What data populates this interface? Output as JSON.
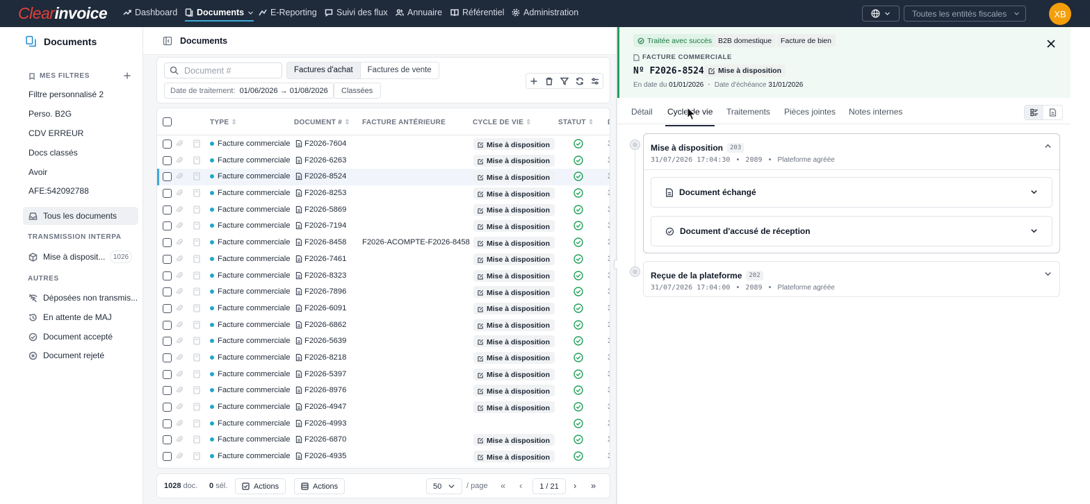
{
  "nav": {
    "logo_a": "Clear",
    "logo_b": "invoice",
    "items": [
      {
        "label": "Dashboard",
        "icon": "trend-icon"
      },
      {
        "label": "Documents",
        "icon": "documents-icon"
      },
      {
        "label": "E-Reporting",
        "icon": "ereporting-icon"
      },
      {
        "label": "Suivi des flux",
        "icon": "chat-icon"
      },
      {
        "label": "Annuaire",
        "icon": "users-icon"
      },
      {
        "label": "Référentiel",
        "icon": "book-icon"
      },
      {
        "label": "Administration",
        "icon": "gear-icon"
      }
    ],
    "entity_placeholder": "Toutes les entités fiscales",
    "avatar": "XB"
  },
  "sidebar": {
    "title": "Documents",
    "filters_header": "MES FILTRES",
    "filters": [
      "Filtre personnalisé 2",
      "Perso. B2G",
      "CDV ERREUR",
      "Docs classés",
      "Avoir",
      "AFE:542092788"
    ],
    "all_docs": "Tous les documents",
    "interpa_header": "TRANSMISSION INTERPA",
    "interpa_item": "Mise à disposit...",
    "interpa_count": "1026",
    "autres_header": "AUTRES",
    "autres": [
      "Déposées non transmis...",
      "En attente de MAJ",
      "Document accepté",
      "Document rejeté"
    ]
  },
  "main": {
    "title": "Documents",
    "search_placeholder": "Document #",
    "seg_purchase": "Factures d'achat",
    "seg_sales": "Factures de vente",
    "date_label": "Date de traitement:",
    "date_value": "01/06/2026 → 01/08/2026",
    "classees": "Classées"
  },
  "table": {
    "headers": {
      "type": "TYPE",
      "doc": "DOCUMENT #",
      "prev": "FACTURE ANTÉRIEURE",
      "cycle": "CYCLE DE VIE",
      "status": "STATUT",
      "trail": "D"
    },
    "rows": [
      {
        "type": "Facture commerciale",
        "doc": "F2026-7604",
        "prev": "",
        "cycle": "Mise à disposition"
      },
      {
        "type": "Facture commerciale",
        "doc": "F2026-6263",
        "prev": "",
        "cycle": "Mise à disposition"
      },
      {
        "type": "Facture commerciale",
        "doc": "F2026-8524",
        "prev": "",
        "cycle": "Mise à disposition",
        "selected": true
      },
      {
        "type": "Facture commerciale",
        "doc": "F2026-8253",
        "prev": "",
        "cycle": "Mise à disposition"
      },
      {
        "type": "Facture commerciale",
        "doc": "F2026-5869",
        "prev": "",
        "cycle": "Mise à disposition"
      },
      {
        "type": "Facture commerciale",
        "doc": "F2026-7194",
        "prev": "",
        "cycle": "Mise à disposition"
      },
      {
        "type": "Facture commerciale",
        "doc": "F2026-8458",
        "prev": "F2026-ACOMPTE-F2026-8458",
        "cycle": "Mise à disposition"
      },
      {
        "type": "Facture commerciale",
        "doc": "F2026-7461",
        "prev": "",
        "cycle": "Mise à disposition"
      },
      {
        "type": "Facture commerciale",
        "doc": "F2026-8323",
        "prev": "",
        "cycle": "Mise à disposition"
      },
      {
        "type": "Facture commerciale",
        "doc": "F2026-7896",
        "prev": "",
        "cycle": "Mise à disposition"
      },
      {
        "type": "Facture commerciale",
        "doc": "F2026-6091",
        "prev": "",
        "cycle": "Mise à disposition"
      },
      {
        "type": "Facture commerciale",
        "doc": "F2026-6862",
        "prev": "",
        "cycle": "Mise à disposition"
      },
      {
        "type": "Facture commerciale",
        "doc": "F2026-5639",
        "prev": "",
        "cycle": "Mise à disposition"
      },
      {
        "type": "Facture commerciale",
        "doc": "F2026-8218",
        "prev": "",
        "cycle": "Mise à disposition"
      },
      {
        "type": "Facture commerciale",
        "doc": "F2026-5397",
        "prev": "",
        "cycle": "Mise à disposition"
      },
      {
        "type": "Facture commerciale",
        "doc": "F2026-8976",
        "prev": "",
        "cycle": "Mise à disposition"
      },
      {
        "type": "Facture commerciale",
        "doc": "F2026-4947",
        "prev": "",
        "cycle": "Mise à disposition"
      },
      {
        "type": "Facture commerciale",
        "doc": "F2026-4993",
        "prev": "",
        "cycle": ""
      },
      {
        "type": "Facture commerciale",
        "doc": "F2026-6870",
        "prev": "",
        "cycle": "Mise à disposition"
      },
      {
        "type": "Facture commerciale",
        "doc": "F2026-4935",
        "prev": "",
        "cycle": "Mise à disposition"
      }
    ],
    "trail_value": "3"
  },
  "footer": {
    "count": "1028",
    "count_unit": "doc.",
    "selected": "0",
    "selected_unit": "sél.",
    "actions1": "Actions",
    "actions2": "Actions",
    "page_size": "50",
    "per_page": "/ page",
    "page": "1 / 21"
  },
  "panel": {
    "chip_status": "Traitée avec succès",
    "chip_b2b": "B2B domestique",
    "chip_goods": "Facture de bien",
    "kind": "FACTURE COMMERCIALE",
    "number": "Nº F2026-8524",
    "state": "Mise à disposition",
    "date_label": "En date du",
    "date_value": "01/01/2026",
    "due_label": "Date d'échéance",
    "due_value": "31/01/2026",
    "tabs": [
      "Détail",
      "Cycle de vie",
      "Traitements",
      "Pièces jointes",
      "Notes internes"
    ],
    "events": [
      {
        "title": "Mise à disposition",
        "code": "203",
        "ts": "31/07/2026 17:04:30",
        "id": "2089",
        "src": "Plateforme agréée",
        "subs": [
          "Document échangé",
          "Document d'accusé de réception"
        ]
      },
      {
        "title": "Reçue de la plateforme",
        "code": "202",
        "ts": "31/07/2026 17:04:00",
        "id": "2089",
        "src": "Plateforme agréée"
      }
    ]
  },
  "colors": {
    "accent": "#3fa9d8",
    "success": "#22a05b",
    "nav_bg": "#1f2a3a",
    "avatar": "#f59e0b"
  }
}
